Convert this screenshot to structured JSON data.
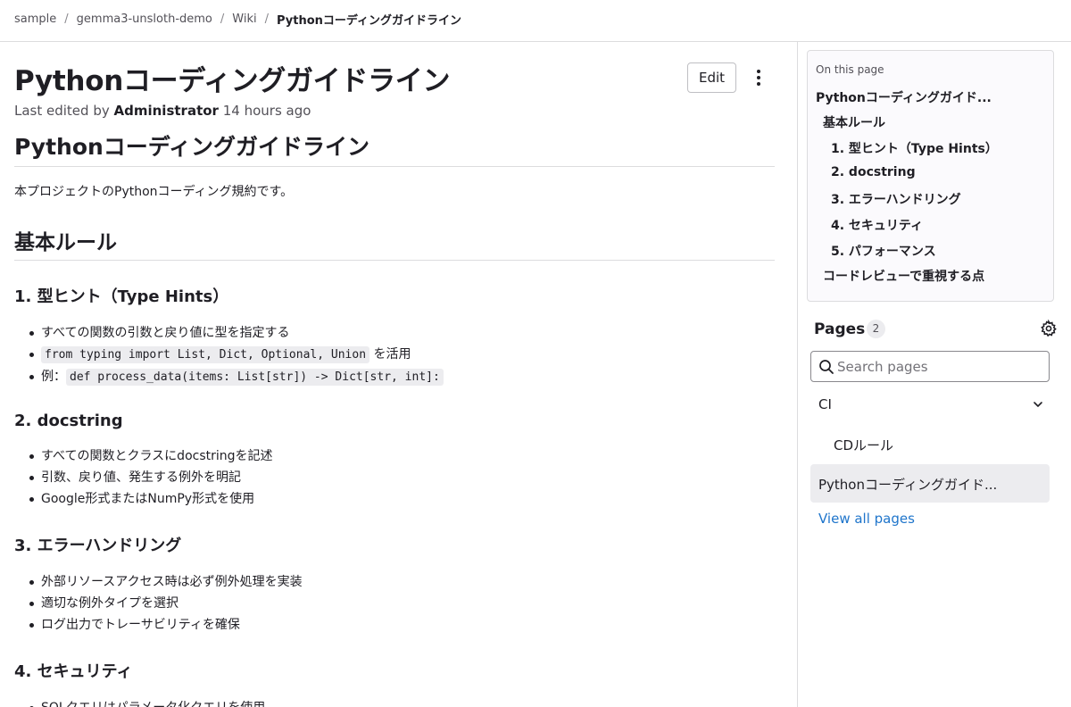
{
  "breadcrumb": [
    {
      "label": "sample"
    },
    {
      "label": "gemma3-unsloth-demo"
    },
    {
      "label": "Wiki"
    },
    {
      "label": "Pythonコーディングガイドライン"
    }
  ],
  "page": {
    "title": "Pythonコーディングガイドライン",
    "meta_prefix": "Last edited by",
    "meta_author": "Administrator",
    "meta_suffix": "14 hours ago",
    "edit_label": "Edit"
  },
  "content": {
    "h1": "Pythonコーディングガイドライン",
    "intro": "本プロジェクトのPythonコーディング規約です。",
    "h2": "基本ルール",
    "s1": {
      "title": "1. 型ヒント（Type Hints）",
      "item1": "すべての関数の引数と戻り値に型を指定する",
      "item2_code": "from typing import List, Dict, Optional, Union",
      "item2_text": " を活用",
      "item3_prefix": "例：",
      "item3_code": "def process_data(items: List[str]) -> Dict[str, int]:"
    },
    "s2": {
      "title": "2. docstring",
      "items": [
        "すべての関数とクラスにdocstringを記述",
        "引数、戻り値、発生する例外を明記",
        "Google形式またはNumPy形式を使用"
      ]
    },
    "s3": {
      "title": "3. エラーハンドリング",
      "items": [
        "外部リソースアクセス時は必ず例外処理を実装",
        "適切な例外タイプを選択",
        "ログ出力でトレーサビリティを確保"
      ]
    },
    "s4": {
      "title": "4. セキュリティ",
      "items": [
        "SQLクエリはパラメータ化クエリを使用"
      ]
    }
  },
  "toc": {
    "heading": "On this page",
    "items": [
      "Pythonコーディングガイド...",
      "基本ルール",
      "1. 型ヒント（Type Hints）",
      "2. docstring",
      "3. エラーハンドリング",
      "4. セキュリティ",
      "5. パフォーマンス",
      "コードレビューで重視する点"
    ]
  },
  "pages": {
    "title": "Pages",
    "count": "2",
    "search_placeholder": "Search pages",
    "tree": [
      "CI",
      "CDルール",
      "Pythonコーディングガイド..."
    ],
    "view_all": "View all pages"
  },
  "icons": {
    "search": "search-icon",
    "gear": "gear-icon",
    "chevron": "chevron-down-icon",
    "kebab": "more-vertical-icon"
  },
  "colors": {
    "link": "#1f75cb",
    "text": "#1f1e24",
    "muted": "#535158",
    "active_bg": "#ececef"
  }
}
